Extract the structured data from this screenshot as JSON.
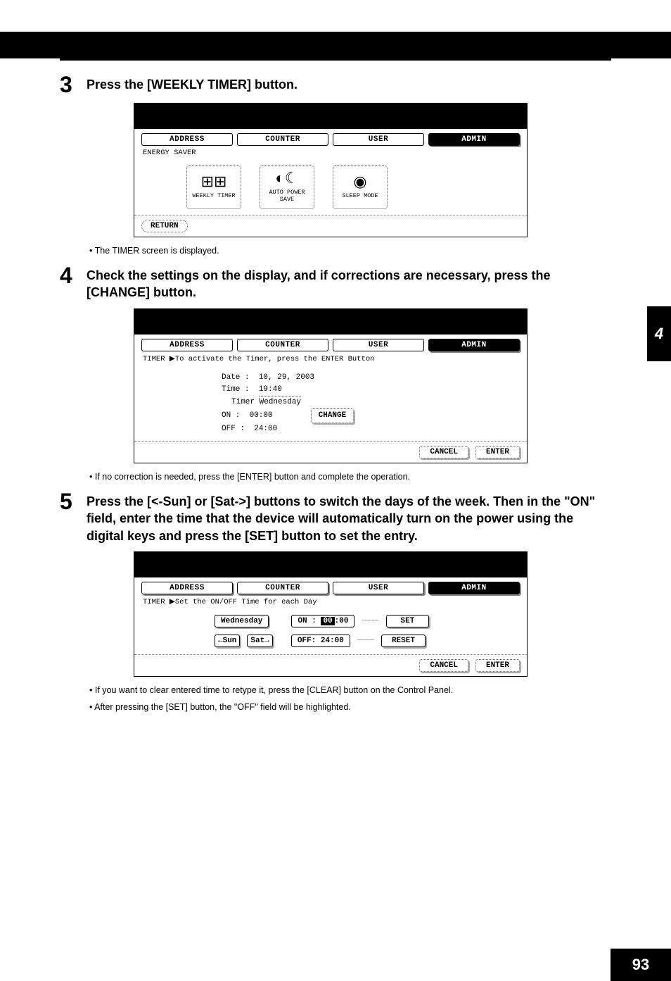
{
  "sideTab": "4",
  "pageNumber": "93",
  "step3": {
    "num": "3",
    "text": "Press the [WEEKLY TIMER] button.",
    "tabs": {
      "address": "ADDRESS",
      "counter": "COUNTER",
      "user": "USER",
      "admin": "ADMIN"
    },
    "subline": "ENERGY SAVER",
    "icons": {
      "weekly": "WEEKLY TIMER",
      "auto": "AUTO POWER\nSAVE",
      "sleep": "SLEEP MODE"
    },
    "return": "RETURN",
    "bullet": "The TIMER screen is displayed."
  },
  "step4": {
    "num": "4",
    "text": "Check the settings on the display, and if corrections are necessary, press the [CHANGE] button.",
    "tabs": {
      "address": "ADDRESS",
      "counter": "COUNTER",
      "user": "USER",
      "admin": "ADMIN"
    },
    "subline": "TIMER  ▶To activate the Timer, press the ENTER Button",
    "info": {
      "dateLabel": "Date :",
      "dateValue": "10, 29, 2003",
      "timeLabel": "Time :",
      "timeValue": "19:40",
      "timerDay": "Timer Wednesday",
      "onLabel": "ON   :",
      "onValue": "00:00",
      "offLabel": "OFF  :",
      "offValue": "24:00",
      "change": "CHANGE"
    },
    "cancel": "CANCEL",
    "enter": "ENTER",
    "bullet": "If no correction is needed, press the [ENTER] button and complete the operation."
  },
  "step5": {
    "num": "5",
    "text": "Press the [<-Sun] or [Sat->] buttons to switch the days of the week. Then in the \"ON\" field, enter the time that the device will automatically turn on the power using the digital keys and press the [SET] button to set the entry.",
    "tabs": {
      "address": "ADDRESS",
      "counter": "COUNTER",
      "user": "USER",
      "admin": "ADMIN"
    },
    "subline": "TIMER            ▶Set the ON/OFF Time for each Day",
    "body": {
      "day": "Wednesday",
      "sun": "←Sun",
      "sat": "Sat→",
      "onLabel": "ON :",
      "onHH": "00",
      "onMM": ":00",
      "offLabel": "OFF:",
      "offValue": "24:00",
      "set": "SET",
      "reset": "RESET"
    },
    "cancel": "CANCEL",
    "enter": "ENTER",
    "bullets": [
      "If you want to clear entered time to retype it, press the [CLEAR] button on the Control Panel.",
      "After pressing the [SET] button, the \"OFF\" field will be highlighted."
    ]
  }
}
